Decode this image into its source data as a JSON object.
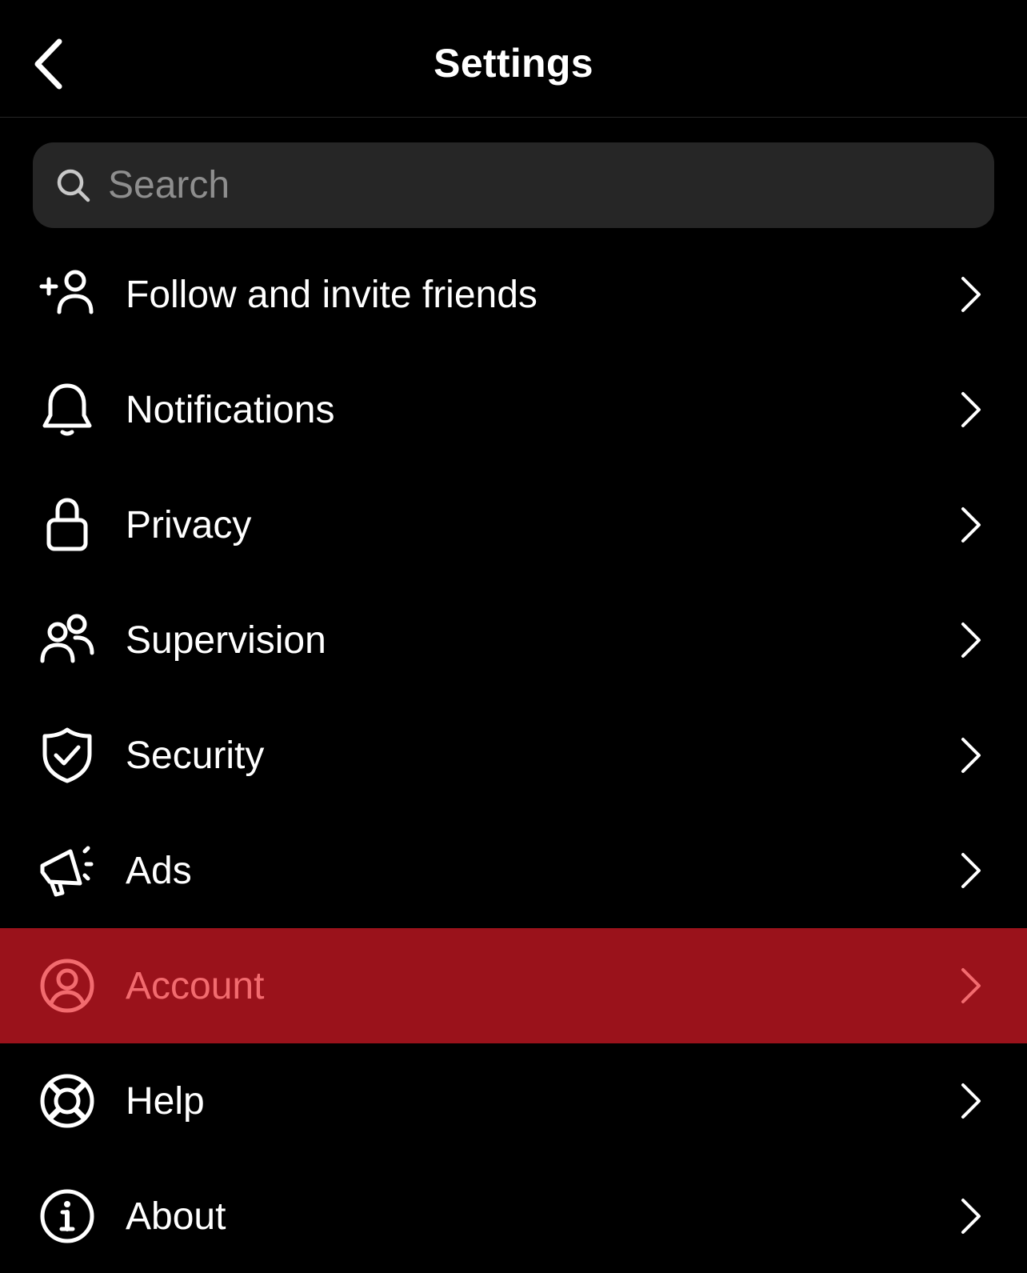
{
  "header": {
    "title": "Settings"
  },
  "search": {
    "placeholder": "Search"
  },
  "menu": {
    "items": [
      {
        "label": "Follow and invite friends",
        "icon": "add-person-icon"
      },
      {
        "label": "Notifications",
        "icon": "bell-icon"
      },
      {
        "label": "Privacy",
        "icon": "lock-icon"
      },
      {
        "label": "Supervision",
        "icon": "people-icon"
      },
      {
        "label": "Security",
        "icon": "shield-check-icon"
      },
      {
        "label": "Ads",
        "icon": "megaphone-icon"
      },
      {
        "label": "Account",
        "icon": "user-circle-icon",
        "highlighted": true
      },
      {
        "label": "Help",
        "icon": "lifebuoy-icon"
      },
      {
        "label": "About",
        "icon": "info-icon"
      }
    ]
  },
  "colors": {
    "background": "#000000",
    "text": "#ffffff",
    "search_bg": "#262626",
    "placeholder": "#8e8e8e",
    "highlight_bg": "#9a121b",
    "highlight_text": "#f26b6f"
  }
}
